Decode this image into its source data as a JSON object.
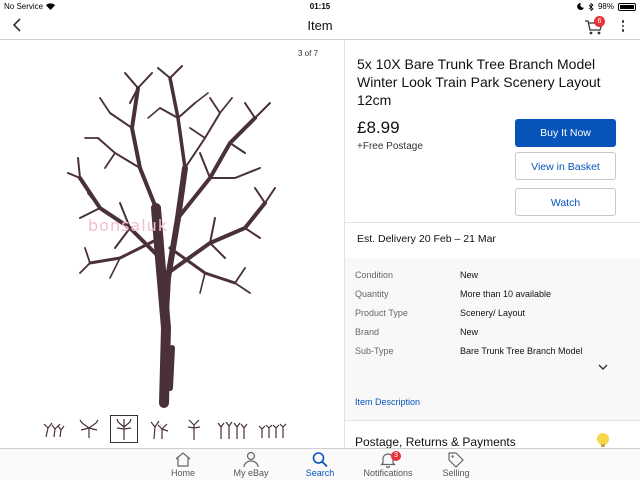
{
  "status_bar": {
    "carrier": "No Service",
    "time": "01:15",
    "battery": "98%"
  },
  "nav": {
    "back_icon": "chevron-left-icon",
    "title": "Item",
    "cart_count": "6",
    "more_icon": "more-vertical-icon"
  },
  "gallery": {
    "counter": "3 of 7",
    "watermark": "bonsaluk",
    "thumbnail_count": 7,
    "selected_thumbnail": 3
  },
  "listing": {
    "title": "5x 10X Bare Trunk Tree Branch Model Winter Look Train Park Scenery Layout 12cm",
    "price": "£8.99",
    "postage": "+Free Postage",
    "buy_label": "Buy It Now",
    "basket_label": "View in Basket",
    "watch_label": "Watch",
    "delivery_label": "Est. Delivery",
    "delivery_dates": "20 Feb – 21 Mar"
  },
  "specs": {
    "rows": [
      {
        "label": "Condition",
        "value": "New"
      },
      {
        "label": "Quantity",
        "value": "More than 10 available"
      },
      {
        "label": "Product Type",
        "value": "Scenery/ Layout"
      },
      {
        "label": "Brand",
        "value": "New"
      },
      {
        "label": "Sub-Type",
        "value": "Bare Trunk Tree Branch Model"
      }
    ],
    "item_description": "Item Description"
  },
  "postage_section": {
    "heading": "Postage, Returns & Payments"
  },
  "tabs": [
    {
      "label": "Home",
      "icon": "home-icon"
    },
    {
      "label": "My eBay",
      "icon": "person-icon"
    },
    {
      "label": "Search",
      "icon": "search-icon"
    },
    {
      "label": "Notifications",
      "icon": "bell-icon",
      "badge": "3"
    },
    {
      "label": "Selling",
      "icon": "tag-icon"
    }
  ],
  "colors": {
    "accent": "#0654ba",
    "badge": "#e53238",
    "tree": "#4a3038"
  }
}
